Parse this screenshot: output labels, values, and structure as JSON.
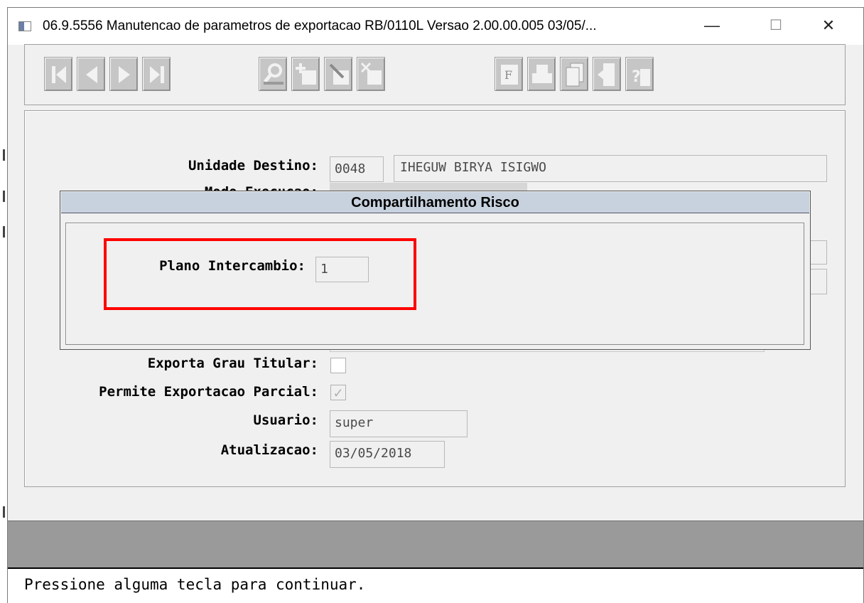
{
  "window": {
    "title": "06.9.5556 Manutencao  de parametros de exportacao RB/0110L Versao 2.00.00.005 03/05/...",
    "controls": {
      "minimize": "—",
      "maximize": "☐",
      "close": "✕"
    }
  },
  "toolbar": {
    "groups": [
      [
        "first-record-icon",
        "previous-record-icon",
        "next-record-icon",
        "last-record-icon"
      ],
      [
        "search-icon",
        "add-icon",
        "edit-icon",
        "delete-icon"
      ],
      [
        "filter-icon",
        "print-icon",
        "copy-icon",
        "exit-icon",
        "help-icon"
      ]
    ]
  },
  "form": {
    "unidade_destino": {
      "label": "Unidade Destino:",
      "code": "0048",
      "name": "IHEGUW BIRYA ISIGWO"
    },
    "modo_execucao": {
      "label": "Modo Execucao:"
    },
    "exporta_grau_titular": {
      "label": "Exporta Grau Titular:",
      "checked": false
    },
    "permite_exportacao_parcial": {
      "label": "Permite Exportacao Parcial:",
      "checked": true,
      "check_glyph": "✓"
    },
    "usuario": {
      "label": "Usuario:",
      "value": "super"
    },
    "atualizacao": {
      "label": "Atualizacao:",
      "value": "03/05/2018"
    }
  },
  "dialog": {
    "title": "Compartilhamento Risco",
    "plano_intercambio": {
      "label": "Plano Intercambio:",
      "value": "1"
    }
  },
  "status": {
    "message": "Pressione alguma tecla para continuar."
  },
  "colors": {
    "highlight": "#ff0000",
    "dialog_title_bg": "#c8d2de",
    "gray_bar": "#9a9a9a"
  }
}
